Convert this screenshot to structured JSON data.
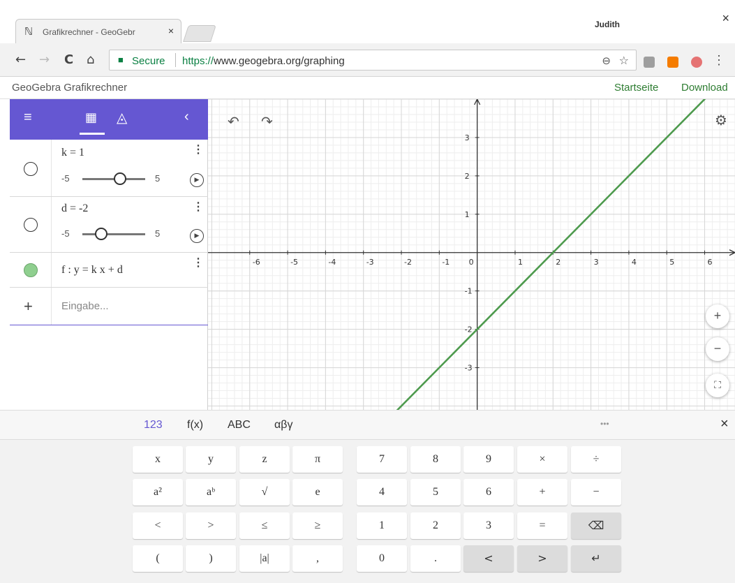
{
  "browser": {
    "tab_title": "Grafikrechner - GeoGebr",
    "tab_close": "×",
    "user": "Judith",
    "window_close": "×",
    "back": "←",
    "forward": "→",
    "reload": "C",
    "home": "⌂",
    "secure_label": "Secure",
    "url_scheme": "https://",
    "url_rest": "www.geogebra.org/graphing",
    "zoom_icon": "⊖",
    "star_icon": "☆",
    "menu_dots": "⋮",
    "extension_colors": [
      "#9e9e9e",
      "#f57c00",
      "#e57373"
    ]
  },
  "header": {
    "app_title": "GeoGebra Grafikrechner",
    "startseite": "Startseite",
    "download": "Download"
  },
  "algebra": {
    "toolbar": {
      "menu": "≡",
      "calc": "▦",
      "geom": "◬",
      "collapse": "‹"
    },
    "kebab": "⋮",
    "play": "▶",
    "items": [
      {
        "definition": "k = 1",
        "slider_min": "-5",
        "slider_max": "5",
        "slider_value": 1
      },
      {
        "definition": "d = -2",
        "slider_min": "-5",
        "slider_max": "5",
        "slider_value": -2
      },
      {
        "definition": "f : y = k x + d"
      }
    ],
    "input_plus": "+",
    "input_placeholder": "Eingabe..."
  },
  "graphics": {
    "undo": "↶",
    "redo": "↷",
    "settings": "⚙",
    "zoom_in": "+",
    "zoom_out": "−",
    "fullscreen": "⛶"
  },
  "chart_data": {
    "type": "line",
    "x_ticks": [
      "-6",
      "-5",
      "-4",
      "-3",
      "-2",
      "-1",
      "0",
      "1",
      "2",
      "3",
      "4",
      "5",
      "6"
    ],
    "y_ticks": [
      "3",
      "2",
      "1",
      "-1",
      "-2",
      "-3"
    ],
    "xlim": [
      -7.1,
      6.8
    ],
    "ylim": [
      -4.1,
      4.0
    ],
    "grid": true,
    "series": [
      {
        "x": [
          -7.1,
          6.8
        ],
        "y": [
          -9.1,
          4.8
        ],
        "color": "#4d9a4d"
      }
    ]
  },
  "keyboard": {
    "tabs": [
      "123",
      "f(x)",
      "ABC",
      "αβγ"
    ],
    "more": "•••",
    "close": "×",
    "rows": [
      [
        "x",
        "y",
        "z",
        "π"
      ],
      [
        "a²",
        "aᵇ",
        "√",
        "e"
      ],
      [
        "<",
        ">",
        "≤",
        "≥"
      ],
      [
        "(",
        ")",
        "|a|",
        ","
      ]
    ],
    "numrows": [
      [
        "7",
        "8",
        "9",
        "×",
        "÷"
      ],
      [
        "4",
        "5",
        "6",
        "+",
        "−"
      ],
      [
        "1",
        "2",
        "3",
        "=",
        "⌫"
      ],
      [
        "0",
        ".",
        "<",
        ">",
        "↵"
      ]
    ]
  }
}
